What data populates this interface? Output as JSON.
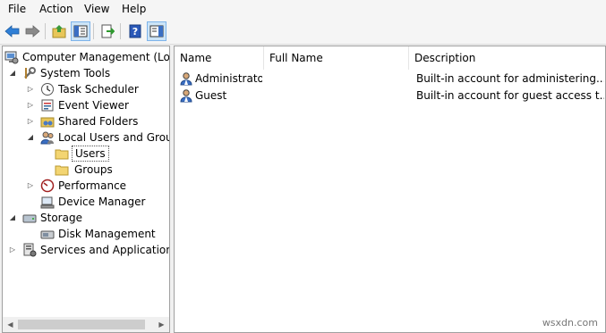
{
  "menu": [
    "File",
    "Action",
    "View",
    "Help"
  ],
  "toolbar": {
    "buttons": [
      "back-icon",
      "forward-icon",
      "up-folder-icon",
      "show-hide-console-tree-icon",
      "export-list-icon",
      "help-icon",
      "show-hide-action-pane-icon"
    ]
  },
  "tree": {
    "root": "Computer Management (Local",
    "system_tools": "System Tools",
    "task_scheduler": "Task Scheduler",
    "event_viewer": "Event Viewer",
    "shared_folders": "Shared Folders",
    "local_users_groups": "Local Users and Groups",
    "users": "Users",
    "groups": "Groups",
    "performance": "Performance",
    "device_manager": "Device Manager",
    "storage": "Storage",
    "disk_management": "Disk Management",
    "services_apps": "Services and Applications"
  },
  "list": {
    "columns": [
      "Name",
      "Full Name",
      "Description"
    ],
    "rows": [
      {
        "name": "Administrator",
        "full_name": "",
        "description": "Built-in account for administering..."
      },
      {
        "name": "Guest",
        "full_name": "",
        "description": "Built-in account for guest access t..."
      }
    ]
  },
  "watermark": "wsxdn.com"
}
